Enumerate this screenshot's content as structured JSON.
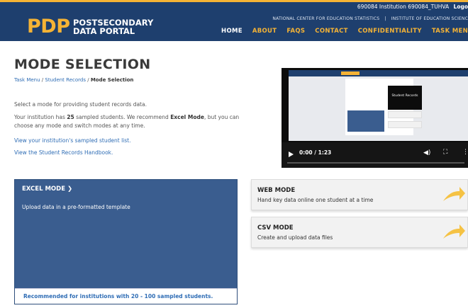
{
  "header": {
    "institution": "690084 Institution",
    "user": "690084_TUHVA",
    "logout": "Logo",
    "logo_mark": "PDP",
    "logo_line1": "POSTSECONDARY",
    "logo_line2": "DATA PORTAL",
    "agency_links": [
      "NATIONAL CENTER FOR EDUCATION STATISTICS",
      "|",
      "INSTITUTE OF EDUCATION SCIENC"
    ],
    "nav": [
      "HOME",
      "ABOUT",
      "FAQS",
      "CONTACT",
      "CONFIDENTIALITY",
      "TASK MEN"
    ],
    "accent": "#f5b335",
    "brand": "#1e3f6e"
  },
  "page": {
    "title": "MODE SELECTION",
    "breadcrumb": {
      "item1": "Task Menu",
      "sep1": " / ",
      "item2": "Student Records",
      "sep2": " / ",
      "current": "Mode Selection"
    },
    "intro": "Select a mode for providing student records data.",
    "para": {
      "t1": "Your institution has ",
      "count": "25",
      "t2": " sampled students. We recommend ",
      "mode": "Excel Mode",
      "t3": ", but you can choose any mode and switch modes at any time."
    },
    "link_list": "View your institution's sampled student list.",
    "link_handbook": "View the Student Records Handbook."
  },
  "video": {
    "time": "0:00 / 1:23",
    "play_icon": "play-icon",
    "volume_icon": "volume-icon",
    "fullscreen_icon": "fullscreen-icon",
    "overlay_caption": "Student Records"
  },
  "modes": {
    "excel": {
      "title": "EXCEL MODE ❯",
      "desc": "Upload data in a pre-formatted template",
      "note": "Recommended for institutions with 20 - 100 sampled students.",
      "color": "#3a5d8f"
    },
    "web": {
      "title": "WEB MODE",
      "desc": "Hand key data online one student at a time"
    },
    "csv": {
      "title": "CSV MODE",
      "desc": "Create and upload data files"
    }
  }
}
